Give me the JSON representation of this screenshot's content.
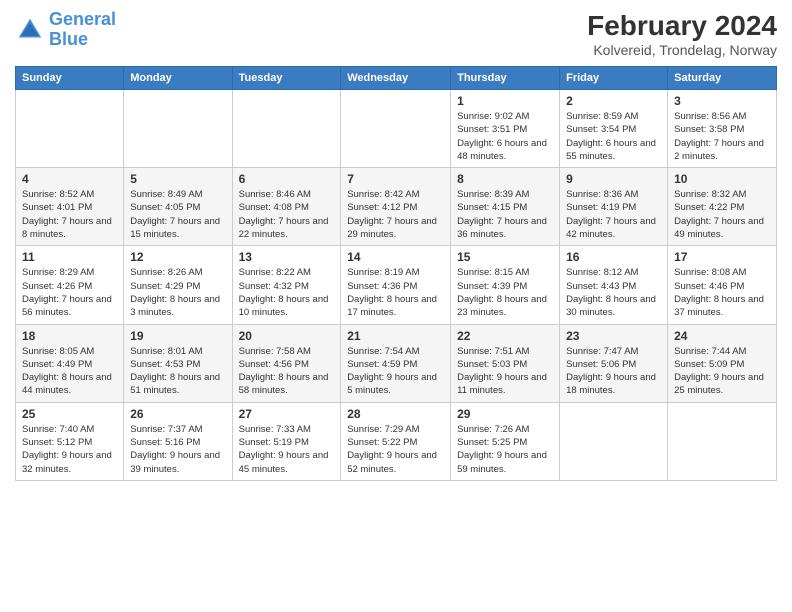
{
  "logo": {
    "line1": "General",
    "line2": "Blue"
  },
  "title": "February 2024",
  "subtitle": "Kolvereid, Trondelag, Norway",
  "days_of_week": [
    "Sunday",
    "Monday",
    "Tuesday",
    "Wednesday",
    "Thursday",
    "Friday",
    "Saturday"
  ],
  "weeks": [
    [
      {
        "day": "",
        "sunrise": "",
        "sunset": "",
        "daylight": ""
      },
      {
        "day": "",
        "sunrise": "",
        "sunset": "",
        "daylight": ""
      },
      {
        "day": "",
        "sunrise": "",
        "sunset": "",
        "daylight": ""
      },
      {
        "day": "",
        "sunrise": "",
        "sunset": "",
        "daylight": ""
      },
      {
        "day": "1",
        "sunrise": "9:02 AM",
        "sunset": "3:51 PM",
        "daylight": "6 hours and 48 minutes."
      },
      {
        "day": "2",
        "sunrise": "8:59 AM",
        "sunset": "3:54 PM",
        "daylight": "6 hours and 55 minutes."
      },
      {
        "day": "3",
        "sunrise": "8:56 AM",
        "sunset": "3:58 PM",
        "daylight": "7 hours and 2 minutes."
      }
    ],
    [
      {
        "day": "4",
        "sunrise": "8:52 AM",
        "sunset": "4:01 PM",
        "daylight": "7 hours and 8 minutes."
      },
      {
        "day": "5",
        "sunrise": "8:49 AM",
        "sunset": "4:05 PM",
        "daylight": "7 hours and 15 minutes."
      },
      {
        "day": "6",
        "sunrise": "8:46 AM",
        "sunset": "4:08 PM",
        "daylight": "7 hours and 22 minutes."
      },
      {
        "day": "7",
        "sunrise": "8:42 AM",
        "sunset": "4:12 PM",
        "daylight": "7 hours and 29 minutes."
      },
      {
        "day": "8",
        "sunrise": "8:39 AM",
        "sunset": "4:15 PM",
        "daylight": "7 hours and 36 minutes."
      },
      {
        "day": "9",
        "sunrise": "8:36 AM",
        "sunset": "4:19 PM",
        "daylight": "7 hours and 42 minutes."
      },
      {
        "day": "10",
        "sunrise": "8:32 AM",
        "sunset": "4:22 PM",
        "daylight": "7 hours and 49 minutes."
      }
    ],
    [
      {
        "day": "11",
        "sunrise": "8:29 AM",
        "sunset": "4:26 PM",
        "daylight": "7 hours and 56 minutes."
      },
      {
        "day": "12",
        "sunrise": "8:26 AM",
        "sunset": "4:29 PM",
        "daylight": "8 hours and 3 minutes."
      },
      {
        "day": "13",
        "sunrise": "8:22 AM",
        "sunset": "4:32 PM",
        "daylight": "8 hours and 10 minutes."
      },
      {
        "day": "14",
        "sunrise": "8:19 AM",
        "sunset": "4:36 PM",
        "daylight": "8 hours and 17 minutes."
      },
      {
        "day": "15",
        "sunrise": "8:15 AM",
        "sunset": "4:39 PM",
        "daylight": "8 hours and 23 minutes."
      },
      {
        "day": "16",
        "sunrise": "8:12 AM",
        "sunset": "4:43 PM",
        "daylight": "8 hours and 30 minutes."
      },
      {
        "day": "17",
        "sunrise": "8:08 AM",
        "sunset": "4:46 PM",
        "daylight": "8 hours and 37 minutes."
      }
    ],
    [
      {
        "day": "18",
        "sunrise": "8:05 AM",
        "sunset": "4:49 PM",
        "daylight": "8 hours and 44 minutes."
      },
      {
        "day": "19",
        "sunrise": "8:01 AM",
        "sunset": "4:53 PM",
        "daylight": "8 hours and 51 minutes."
      },
      {
        "day": "20",
        "sunrise": "7:58 AM",
        "sunset": "4:56 PM",
        "daylight": "8 hours and 58 minutes."
      },
      {
        "day": "21",
        "sunrise": "7:54 AM",
        "sunset": "4:59 PM",
        "daylight": "9 hours and 5 minutes."
      },
      {
        "day": "22",
        "sunrise": "7:51 AM",
        "sunset": "5:03 PM",
        "daylight": "9 hours and 11 minutes."
      },
      {
        "day": "23",
        "sunrise": "7:47 AM",
        "sunset": "5:06 PM",
        "daylight": "9 hours and 18 minutes."
      },
      {
        "day": "24",
        "sunrise": "7:44 AM",
        "sunset": "5:09 PM",
        "daylight": "9 hours and 25 minutes."
      }
    ],
    [
      {
        "day": "25",
        "sunrise": "7:40 AM",
        "sunset": "5:12 PM",
        "daylight": "9 hours and 32 minutes."
      },
      {
        "day": "26",
        "sunrise": "7:37 AM",
        "sunset": "5:16 PM",
        "daylight": "9 hours and 39 minutes."
      },
      {
        "day": "27",
        "sunrise": "7:33 AM",
        "sunset": "5:19 PM",
        "daylight": "9 hours and 45 minutes."
      },
      {
        "day": "28",
        "sunrise": "7:29 AM",
        "sunset": "5:22 PM",
        "daylight": "9 hours and 52 minutes."
      },
      {
        "day": "29",
        "sunrise": "7:26 AM",
        "sunset": "5:25 PM",
        "daylight": "9 hours and 59 minutes."
      },
      {
        "day": "",
        "sunrise": "",
        "sunset": "",
        "daylight": ""
      },
      {
        "day": "",
        "sunrise": "",
        "sunset": "",
        "daylight": ""
      }
    ]
  ]
}
